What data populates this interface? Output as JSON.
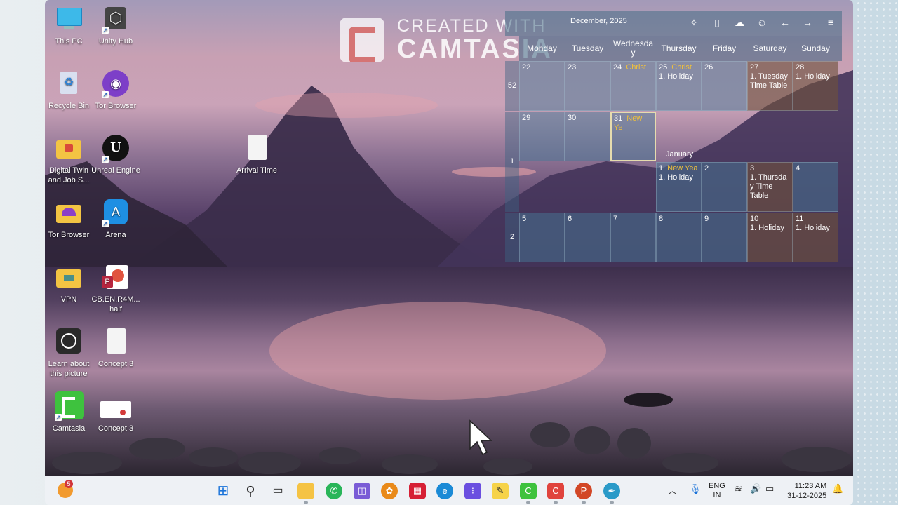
{
  "watermark": {
    "line1": "CREATED WITH",
    "line2": "CAMTASIA"
  },
  "desktop_icons": [
    {
      "id": "this-pc",
      "label": "This PC",
      "icon": "monitor-icon"
    },
    {
      "id": "unity-hub",
      "label": "Unity Hub",
      "icon": "unity-icon"
    },
    {
      "id": "recycle-bin",
      "label": "Recycle Bin",
      "icon": "recycle-bin-icon"
    },
    {
      "id": "tor-browser-1",
      "label": "Tor Browser",
      "icon": "tor-icon"
    },
    {
      "id": "digital-twin",
      "label": "Digital Twin and Job S...",
      "icon": "folder-icon"
    },
    {
      "id": "unreal-engine",
      "label": "Unreal Engine",
      "icon": "unreal-icon"
    },
    {
      "id": "arrival-time",
      "label": "Arrival Time",
      "icon": "file-icon"
    },
    {
      "id": "tor-browser-2",
      "label": "Tor Browser",
      "icon": "folder-icon"
    },
    {
      "id": "arena",
      "label": "Arena",
      "icon": "arena-icon"
    },
    {
      "id": "vpn",
      "label": "VPN",
      "icon": "folder-icon"
    },
    {
      "id": "cb-en",
      "label": "CB.EN.R4M... half",
      "icon": "powerpoint-icon"
    },
    {
      "id": "learn-picture",
      "label": "Learn about this picture",
      "icon": "camera-icon"
    },
    {
      "id": "concept-3-a",
      "label": "Concept 3",
      "icon": "file-icon"
    },
    {
      "id": "camtasia",
      "label": "Camtasia",
      "icon": "camtasia-icon"
    },
    {
      "id": "concept-3-b",
      "label": "Concept 3",
      "icon": "image-file-icon"
    }
  ],
  "calendar": {
    "month_label": "December, 2025",
    "toolbar_icons": [
      "puzzle-icon",
      "phone-icon",
      "cloud-check-icon",
      "person-icon",
      "arrow-left-icon",
      "arrow-right-icon",
      "menu-icon"
    ],
    "days": [
      "Monday",
      "Tuesday",
      "Wednesday",
      "Thursday",
      "Friday",
      "Saturday",
      "Sunday"
    ],
    "day_header_display": [
      "Monday",
      "Tuesday",
      "Wednesda y",
      "Thursday",
      "Friday",
      "Saturday",
      "Sunday"
    ],
    "weeks": [
      {
        "week": "52",
        "cells": [
          {
            "date": "22",
            "event": "",
            "note": ""
          },
          {
            "date": "23",
            "event": "",
            "note": ""
          },
          {
            "date": "24",
            "event": "Christ",
            "note": ""
          },
          {
            "date": "25",
            "event": "Christ",
            "note": "1. Holiday"
          },
          {
            "date": "26",
            "event": "",
            "note": ""
          },
          {
            "date": "27",
            "event": "",
            "note": "1. Tuesday Time Table"
          },
          {
            "date": "28",
            "event": "",
            "note": "1. Holiday"
          }
        ]
      },
      {
        "week": "1",
        "cells": [
          {
            "date": "29",
            "event": "",
            "note": ""
          },
          {
            "date": "30",
            "event": "",
            "note": ""
          },
          {
            "date": "31",
            "event": "New Ye",
            "note": ""
          },
          {
            "date": "1",
            "event": "New Yea",
            "note": "1. Holiday"
          },
          {
            "date": "2",
            "event": "",
            "note": ""
          },
          {
            "date": "3",
            "event": "",
            "note": "1. Thursda y Time Table"
          },
          {
            "date": "4",
            "event": "",
            "note": ""
          }
        ]
      },
      {
        "week": "2",
        "cells": [
          {
            "date": "5",
            "event": "",
            "note": ""
          },
          {
            "date": "6",
            "event": "",
            "note": ""
          },
          {
            "date": "7",
            "event": "",
            "note": ""
          },
          {
            "date": "8",
            "event": "",
            "note": ""
          },
          {
            "date": "9",
            "event": "",
            "note": ""
          },
          {
            "date": "10",
            "event": "",
            "note": "1. Holiday"
          },
          {
            "date": "11",
            "event": "",
            "note": "1. Holiday"
          }
        ]
      }
    ],
    "january_label": "January"
  },
  "taskbar": {
    "notification_count": "5",
    "apps": [
      "start-icon",
      "search-icon",
      "task-view-icon",
      "file-explorer-icon",
      "whatsapp-icon",
      "copilot-icon",
      "app-orange-icon",
      "app-red-icon",
      "edge-icon",
      "apps-grid-icon",
      "sticky-notes-icon",
      "camtasia-icon",
      "camtasia-recorder-icon",
      "powerpoint-icon",
      "feather-icon"
    ],
    "language": {
      "line1": "ENG",
      "line2": "IN"
    },
    "time": "11:23 AM",
    "date": "31-12-2025"
  },
  "colors": {
    "event": "#f0c13b",
    "weekend_cell": "#6e503c",
    "week_cell": "#467896",
    "taskbar": "#eef1f5"
  }
}
